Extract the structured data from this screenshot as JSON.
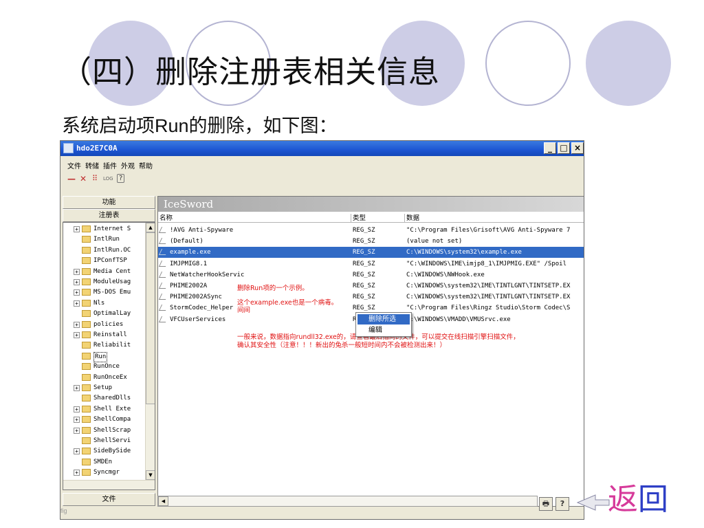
{
  "slide": {
    "title": "（四）删除注册表相关信息",
    "subtitle_prefix": "系统启动项",
    "subtitle_run": "Run",
    "subtitle_suffix": "的删除，如下图：",
    "back_char1": "返",
    "back_char2": "回",
    "fig_label": "fig"
  },
  "window": {
    "title": "hdo2E7C0A",
    "minimize": "_",
    "maximize": "□",
    "close": "×",
    "menu": [
      "文件",
      "转储",
      "插件",
      "外观",
      "帮助"
    ],
    "toolbar": [
      "—",
      "✕",
      "⠿",
      "LOG",
      "?"
    ]
  },
  "left_panel": {
    "functions_label": "功能",
    "registry_label": "注册表",
    "footer_label": "文件",
    "tree": [
      {
        "label": "Internet S",
        "expandable": true
      },
      {
        "label": "IntlRun",
        "expandable": false
      },
      {
        "label": "IntlRun.OC",
        "expandable": false
      },
      {
        "label": "IPConfTSP",
        "expandable": false
      },
      {
        "label": "Media Cent",
        "expandable": true
      },
      {
        "label": "ModuleUsag",
        "expandable": true
      },
      {
        "label": "MS-DOS Emu",
        "expandable": true
      },
      {
        "label": "Nls",
        "expandable": true
      },
      {
        "label": "OptimalLay",
        "expandable": false
      },
      {
        "label": "policies",
        "expandable": true
      },
      {
        "label": "Reinstall",
        "expandable": true
      },
      {
        "label": "Reliabilit",
        "expandable": false
      },
      {
        "label": "Run",
        "expandable": false,
        "selected": true
      },
      {
        "label": "RunOnce",
        "expandable": false
      },
      {
        "label": "RunOnceEx",
        "expandable": false
      },
      {
        "label": "Setup",
        "expandable": true
      },
      {
        "label": "SharedDlls",
        "expandable": false
      },
      {
        "label": "Shell Exte",
        "expandable": true
      },
      {
        "label": "ShellCompa",
        "expandable": true
      },
      {
        "label": "ShellScrap",
        "expandable": true
      },
      {
        "label": "ShellServi",
        "expandable": false
      },
      {
        "label": "SideBySide",
        "expandable": true
      },
      {
        "label": "SMDEn",
        "expandable": false
      },
      {
        "label": "Syncmgr",
        "expandable": true
      }
    ]
  },
  "right_panel": {
    "brand": "IceSword",
    "columns": {
      "name": "名称",
      "type": "类型",
      "data": "数据"
    },
    "rows": [
      {
        "name": "!AVG Anti-Spyware",
        "type": "REG_SZ",
        "data": "\"C:\\Program Files\\Grisoft\\AVG Anti-Spyware 7"
      },
      {
        "name": "(Default)",
        "type": "REG_SZ",
        "data": "(value not set)"
      },
      {
        "name": "example.exe",
        "type": "REG_SZ",
        "data": "C:\\WINDOWS\\system32\\example.exe",
        "selected": true
      },
      {
        "name": "IMJPMIG8.1",
        "type": "REG_SZ",
        "data": "\"C:\\WINDOWS\\IME\\imjp8_1\\IMJPMIG.EXE\" /Spoil"
      },
      {
        "name": "NetWatcherHookServic",
        "type": "REG_SZ",
        "data": "C:\\WINDOWS\\NWHook.exe"
      },
      {
        "name": "PHIME2002A",
        "type": "REG_SZ",
        "data": "C:\\WINDOWS\\system32\\IME\\TINTLGNT\\TINTSETP.EX"
      },
      {
        "name": "PHIME2002ASync",
        "type": "REG_SZ",
        "data": "C:\\WINDOWS\\system32\\IME\\TINTLGNT\\TINTSETP.EX"
      },
      {
        "name": "StormCodec_Helper",
        "type": "REG_SZ",
        "data": "\"C:\\Program Files\\Ringz Studio\\Storm Codec\\S"
      },
      {
        "name": "VFCUserServices",
        "type": "REG_SZ",
        "data": "C:\\WINDOWS\\VMADD\\VMUSrvc.exe"
      }
    ],
    "context_menu": [
      "删除所选",
      "编辑"
    ],
    "annotations": {
      "note1": "删除Run项的一个示例。",
      "note2_line1": "这个example.exe也是一个病毒。",
      "note2_line2": "间间",
      "note3_line1": "一般来说，数据指向rundll32.exe的，请查看最后指向的文件，可以提交在线扫描引擎扫描文件，",
      "note3_line2": "确认其安全性（注意！！！新出的兔杀一般短时间内不会被检测出来！）"
    }
  },
  "statusbar": {
    "left_arrow": "◀",
    "printer": "🖶",
    "help": "?"
  },
  "colors": {
    "selection": "#316ac5",
    "annotation": "#e01010",
    "titlebar": "#1c55d2",
    "circle_fill": "#cdcde6"
  }
}
